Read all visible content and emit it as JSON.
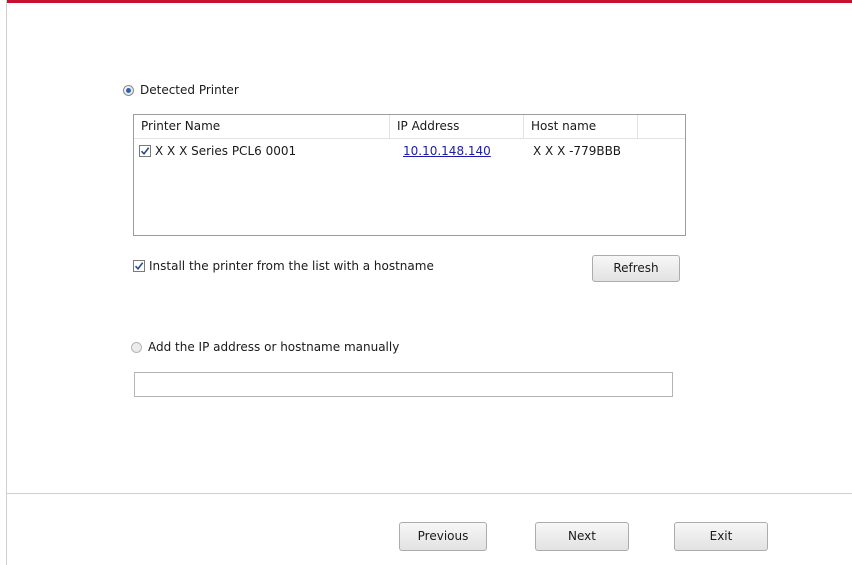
{
  "detected_option": {
    "label": "Detected Printer",
    "selected": true
  },
  "printer_list": {
    "columns": {
      "name": "Printer Name",
      "ip": "IP Address",
      "host": "Host name"
    },
    "rows": [
      {
        "checked": true,
        "name": "X X X  Series PCL6 0001",
        "ip": "10.10.148.140",
        "host": "X X X -779BBB"
      }
    ]
  },
  "hostname_option": {
    "label": "Install the printer from the list with a hostname",
    "checked": true
  },
  "refresh_label": "Refresh",
  "manual_option": {
    "label": "Add the IP address or hostname manually",
    "selected": false
  },
  "manual_input": {
    "value": "",
    "placeholder": ""
  },
  "footer": {
    "previous": "Previous",
    "next": "Next",
    "exit": "Exit"
  },
  "colors": {
    "accent_bar": "#c8102e",
    "link": "#1c1ca8",
    "radio_dot": "#2b63b8"
  }
}
